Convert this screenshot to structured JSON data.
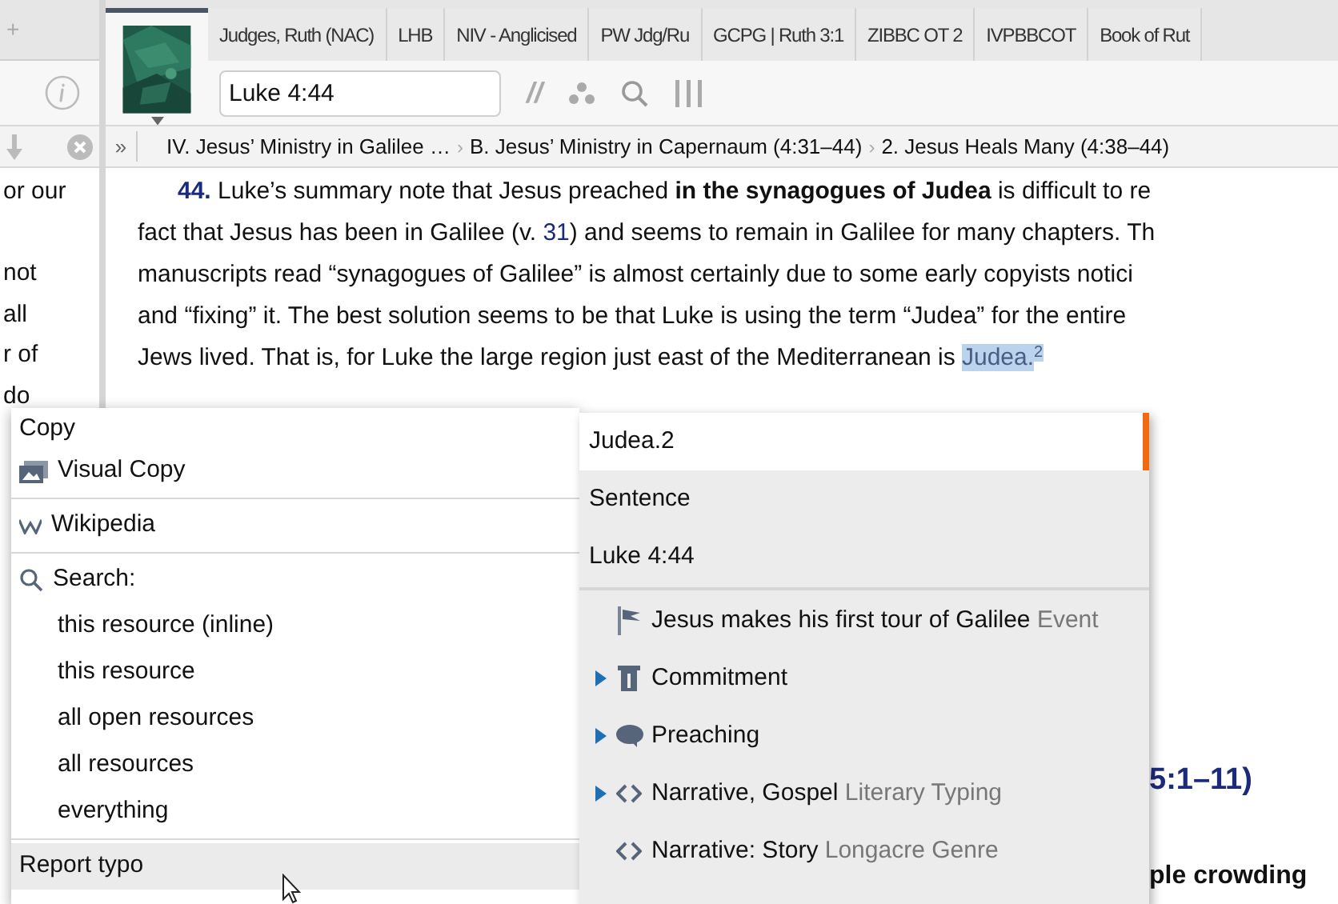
{
  "left_pane": {
    "add_glyph": "+",
    "lines": [
      "or our",
      "not",
      "all",
      "r of",
      "do"
    ]
  },
  "tabs": [
    {
      "kind": "cover",
      "selected": true
    },
    {
      "kind": "text",
      "label": "Judges, Ruth (NAC)",
      "selected": false
    },
    {
      "kind": "text",
      "label": "LHB",
      "selected": false
    },
    {
      "kind": "text",
      "label": "NIV - Anglicised",
      "selected": false
    },
    {
      "kind": "text",
      "label": "PW Jdg/Ru",
      "selected": false
    },
    {
      "kind": "text",
      "label": "GCPG | Ruth 3:1",
      "selected": false
    },
    {
      "kind": "text",
      "label": "ZIBBC OT 2",
      "selected": false
    },
    {
      "kind": "text",
      "label": "IVPBBCOT",
      "selected": false
    },
    {
      "kind": "text",
      "label": "Book of Rut",
      "selected": false
    }
  ],
  "reference_field": {
    "value": "Luke 4:44"
  },
  "parallel_glyph": "//",
  "breadcrumb_expander": "»",
  "breadcrumbs": [
    {
      "label": "IV. Jesus’ Ministry in Galilee …"
    },
    {
      "separator": "›",
      "label": "B. Jesus’ Ministry in Capernaum (4:31–44)"
    },
    {
      "separator": "›",
      "label": "2. Jesus Heals Many (4:38–44)"
    }
  ],
  "article": {
    "lines": [
      [
        {
          "kind": "verse",
          "text": "44."
        },
        {
          "kind": "plain",
          "text": " Luke’s summary note that Jesus preached "
        },
        {
          "kind": "bold",
          "text": "in the synagogues of Judea"
        },
        {
          "kind": "plain",
          "text": " is difficult to re"
        }
      ],
      [
        {
          "kind": "plain",
          "text": "fact that Jesus has been in Galilee (v. "
        },
        {
          "kind": "link",
          "text": "31"
        },
        {
          "kind": "plain",
          "text": ") and seems to remain in Galilee for many chapters. Th"
        }
      ],
      [
        {
          "kind": "plain",
          "text": "manuscripts read “synagogues of Galilee” is almost certainly due to some early copyists notici"
        }
      ],
      [
        {
          "kind": "plain",
          "text": "and “fixing” it. The best solution seems to be that Luke is using the term “Judea” for the entire"
        }
      ],
      [
        {
          "kind": "plain",
          "text": "Jews lived. That is, for Luke the large region just east of the Mediterranean is "
        },
        {
          "kind": "highlight",
          "text": "Judea."
        },
        {
          "kind": "footnote",
          "text": "2"
        }
      ]
    ],
    "heading_fragment": "5:1–11)",
    "bold_fragment": "ple crowding"
  },
  "context_menu": {
    "items": [
      {
        "kind": "copy",
        "label": "Copy",
        "selected": false
      },
      {
        "kind": "visual_copy",
        "label": "Visual Copy",
        "selected": false
      },
      {
        "kind": "divider"
      },
      {
        "kind": "wikipedia",
        "label": "Wikipedia",
        "selected": false
      },
      {
        "kind": "divider"
      },
      {
        "kind": "search",
        "label": "Search:",
        "selected": false
      },
      {
        "kind": "sub",
        "label": "this resource (inline)",
        "selected": false
      },
      {
        "kind": "sub",
        "label": "this resource",
        "selected": false
      },
      {
        "kind": "sub",
        "label": "all open resources",
        "selected": false
      },
      {
        "kind": "sub",
        "label": "all resources",
        "selected": false
      },
      {
        "kind": "sub",
        "label": "everything",
        "selected": false
      },
      {
        "kind": "divider"
      },
      {
        "kind": "copy",
        "label": "Report typo",
        "selected": true
      }
    ]
  },
  "selection_panel": {
    "levels": [
      {
        "label": "Judea.2",
        "selected": true
      },
      {
        "label": "Sentence",
        "selected": false
      },
      {
        "label": "Luke 4:44",
        "selected": false
      }
    ],
    "topics": [
      {
        "kind": "event",
        "label": "Jesus makes his first tour of Galilee",
        "type": "Event",
        "expandable": false
      },
      {
        "kind": "commitment",
        "label": "Commitment",
        "expandable": true
      },
      {
        "kind": "preaching",
        "label": "Preaching",
        "expandable": true
      },
      {
        "kind": "literary",
        "label": "Narrative, Gospel",
        "type": "Literary Typing",
        "expandable": true
      },
      {
        "kind": "literary",
        "label": "Narrative: Story",
        "type": "Longacre Genre",
        "expandable": false
      }
    ]
  }
}
